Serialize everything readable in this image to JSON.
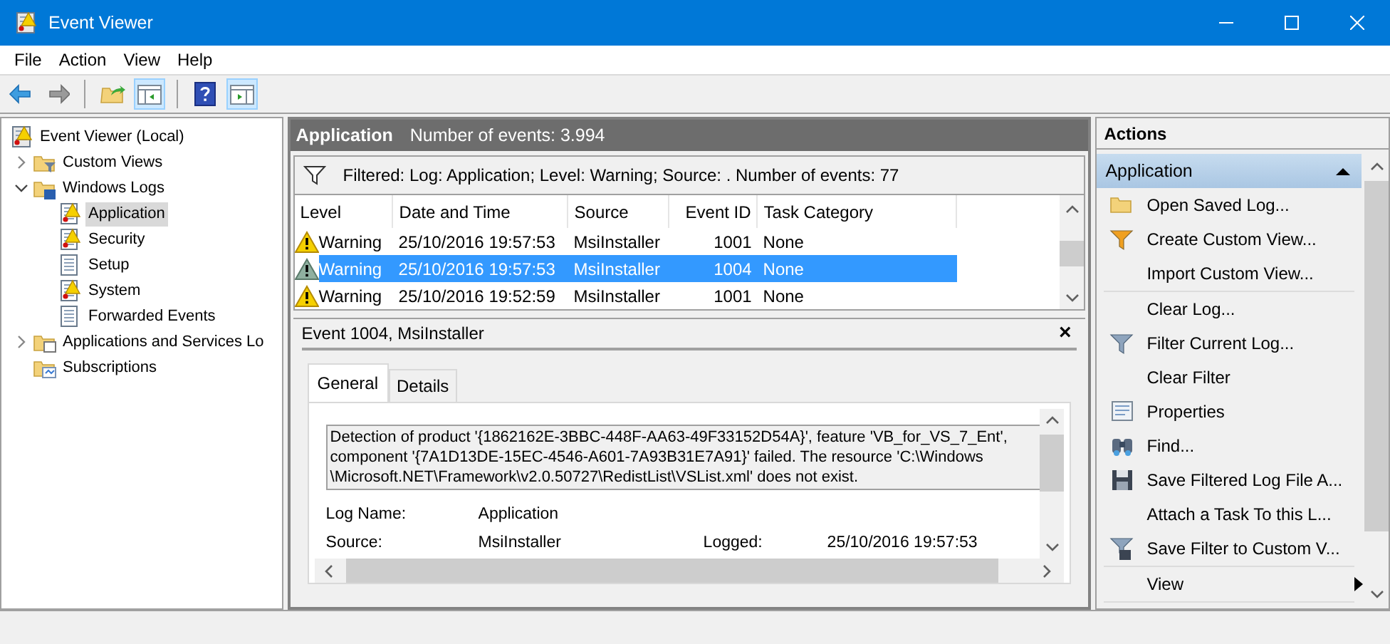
{
  "window": {
    "title": "Event Viewer"
  },
  "menu": [
    "File",
    "Action",
    "View",
    "Help"
  ],
  "toolbar": [
    {
      "kind": "back",
      "pressed": false
    },
    {
      "kind": "forward",
      "pressed": false
    },
    {
      "kind": "separator"
    },
    {
      "kind": "up",
      "pressed": false
    },
    {
      "kind": "tree_pane",
      "pressed": true
    },
    {
      "kind": "separator"
    },
    {
      "kind": "help",
      "pressed": false
    },
    {
      "kind": "action_pane",
      "pressed": true
    }
  ],
  "tree": [
    {
      "label": "Event Viewer (Local)",
      "kind": "viewer",
      "selected": false,
      "children": [
        {
          "label": "Custom Views",
          "kind": "folder_filter",
          "expanded": false,
          "selected": false
        },
        {
          "label": "Windows Logs",
          "kind": "folder_logs",
          "expanded": true,
          "selected": false,
          "children": [
            {
              "label": "Application",
              "kind": "log_warn",
              "selected": true
            },
            {
              "label": "Security",
              "kind": "log_warn",
              "selected": false
            },
            {
              "label": "Setup",
              "kind": "log",
              "selected": false
            },
            {
              "label": "System",
              "kind": "log_warn",
              "selected": false
            },
            {
              "label": "Forwarded Events",
              "kind": "log",
              "selected": false
            }
          ]
        },
        {
          "label": "Applications and Services Lo",
          "kind": "folder_doc",
          "expanded": false,
          "selected": false
        },
        {
          "label": "Subscriptions",
          "kind": "folder_sub",
          "selected": false
        }
      ]
    }
  ],
  "log_header": {
    "title": "Application",
    "count": "Number of events: 3.994"
  },
  "filter_text": "Filtered: Log: Application; Level: Warning; Source: . Number of events: 77",
  "table": {
    "columns": [
      "Level",
      "Date and Time",
      "Source",
      "Event ID",
      "Task Category"
    ],
    "rows": [
      {
        "cells": [
          "Warning",
          "25/10/2016 19:57:53",
          "MsiInstaller",
          "1001",
          "None"
        ],
        "selected": false
      },
      {
        "cells": [
          "Warning",
          "25/10/2016 19:57:53",
          "MsiInstaller",
          "1004",
          "None"
        ],
        "selected": true
      },
      {
        "cells": [
          "Warning",
          "25/10/2016 19:52:59",
          "MsiInstaller",
          "1001",
          "None"
        ],
        "selected": false
      }
    ]
  },
  "detail": {
    "title": "Event 1004, MsiInstaller",
    "close": "×",
    "tabs": [
      {
        "label": "General",
        "selected": true
      },
      {
        "label": "Details",
        "selected": false
      }
    ],
    "message": "Detection of product '{1862162E-3BBC-448F-AA63-49F33152D54A}', feature 'VB_for_VS_7_Ent', component '{7A1D13DE-15EC-4546-A601-7A93B31E7A91}' failed.  The resource 'C:\\Windows \\Microsoft.NET\\Framework\\v2.0.50727\\RedistList\\VSList.xml' does not exist.",
    "fields": [
      [
        "Log Name:",
        "Application"
      ],
      [
        "Source:",
        "MsiInstaller",
        "Logged:",
        "25/10/2016 19:57:53"
      ]
    ]
  },
  "actions": {
    "title": "Actions",
    "section": {
      "label": "Application",
      "expanded": true
    },
    "groups": [
      [
        {
          "label": "Open Saved Log...",
          "kind": "open"
        },
        {
          "label": "Create Custom View...",
          "kind": "funnel_star"
        },
        {
          "label": "Import Custom View...",
          "kind": "none"
        }
      ],
      [
        {
          "label": "Clear Log...",
          "kind": "none"
        },
        {
          "label": "Filter Current Log...",
          "kind": "funnel"
        },
        {
          "label": "Clear Filter",
          "kind": "none"
        },
        {
          "label": "Properties",
          "kind": "properties"
        },
        {
          "label": "Find...",
          "kind": "find"
        },
        {
          "label": "Save Filtered Log File A...",
          "kind": "save"
        },
        {
          "label": "Attach a Task To this L...",
          "kind": "none"
        },
        {
          "label": "Save Filter to Custom V...",
          "kind": "funnel_save"
        }
      ],
      [
        {
          "label": "View",
          "kind": "none",
          "submenu": true
        }
      ]
    ]
  }
}
